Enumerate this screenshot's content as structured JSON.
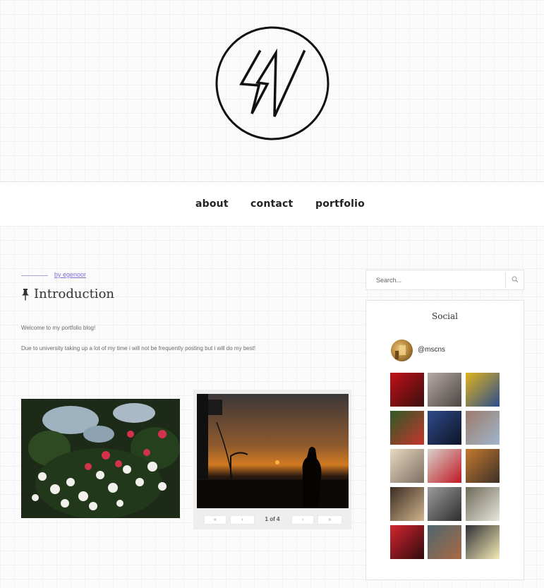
{
  "nav": {
    "items": [
      {
        "label": "about"
      },
      {
        "label": "contact"
      },
      {
        "label": "portfolio"
      }
    ]
  },
  "post": {
    "author": "by egenoor",
    "title": "Introduction",
    "paragraphs": [
      "Welcome to my portfolio blog!",
      "Due to university taking up a lot of my time i will not be frequently posting but i will do my best!"
    ],
    "gallery": {
      "counter": "1 of 4",
      "first_label": "«",
      "prev_label": "‹",
      "next_label": "›",
      "last_label": "»"
    }
  },
  "sidebar": {
    "search": {
      "placeholder": "Search..."
    },
    "social": {
      "title": "Social",
      "handle": "@mscns",
      "thumb_colors": [
        [
          "#c21218",
          "#3a0e10"
        ],
        [
          "#b6aaa4",
          "#4b4541"
        ],
        [
          "#e0b31f",
          "#2b4c8c"
        ],
        [
          "#2c5b28",
          "#c7342b"
        ],
        [
          "#2f4b88",
          "#0d1428"
        ],
        [
          "#9c7b6a",
          "#9fb6cc"
        ],
        [
          "#e9d9bf",
          "#7d6e63"
        ],
        [
          "#d8d2cc",
          "#c01822"
        ],
        [
          "#c4782e",
          "#3b3026"
        ],
        [
          "#3a2c21",
          "#d1b38d"
        ],
        [
          "#9b9b9b",
          "#2d2d2d"
        ],
        [
          "#6e6a57",
          "#e8e6df"
        ],
        [
          "#d32630",
          "#2f0b0e"
        ],
        [
          "#4e6670",
          "#a96a43"
        ],
        [
          "#2f2f35",
          "#f4ecb6"
        ]
      ]
    }
  },
  "colors": {
    "accent": "#7a6fd6"
  }
}
